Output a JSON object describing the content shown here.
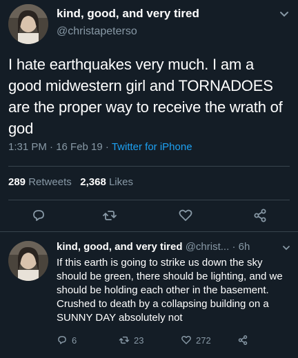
{
  "tweet": {
    "display_name": "kind, good, and very tired",
    "handle": "@christapeterso",
    "text": "I hate earthquakes very much. I am a good midwestern girl and TORNADOES are the proper way to receive the wrath of god",
    "time": "1:31 PM · 16 Feb 19 · ",
    "source": "Twitter for iPhone",
    "retweets_count": "289",
    "retweets_label": "Retweets",
    "likes_count": "2,368",
    "likes_label": "Likes"
  },
  "reply": {
    "display_name": "kind, good, and very tired",
    "handle": "@christ...",
    "time": "· 6h",
    "text": "If this earth is going to strike us down the sky should be green, there should be lighting, and we should be holding each other in the basement. Crushed to death by a collapsing building on a SUNNY DAY absolutely not",
    "reply_count": "6",
    "retweet_count": "23",
    "like_count": "272"
  },
  "colors": {
    "background": "#141d26",
    "muted": "#8899a6",
    "accent": "#1da1f2",
    "divider": "#38444d"
  },
  "icons": [
    "avatar",
    "chevron-down-icon",
    "reply-icon",
    "retweet-icon",
    "like-icon",
    "share-icon"
  ]
}
